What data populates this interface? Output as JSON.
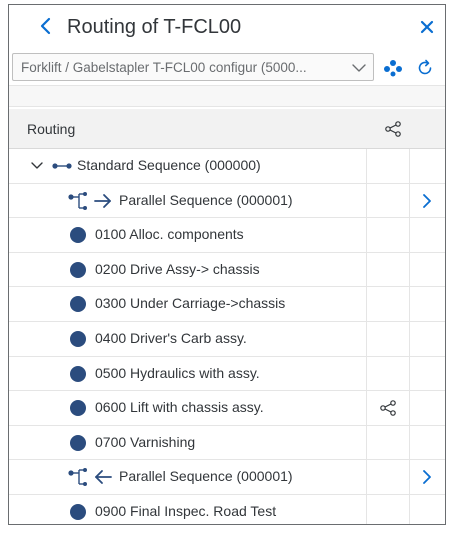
{
  "header": {
    "title": "Routing of T-FCL00"
  },
  "toolbar": {
    "select_value": "Forklift / Gabelstapler T-FCL00 configur (5000..."
  },
  "table": {
    "column_header": "Routing",
    "rows": [
      {
        "kind": "sequence",
        "label": "Standard Sequence (000000)"
      },
      {
        "kind": "parallel-in",
        "label": "Parallel Sequence (000001)"
      },
      {
        "kind": "operation",
        "label": "0100 Alloc. components"
      },
      {
        "kind": "operation",
        "label": "0200 Drive Assy-> chassis"
      },
      {
        "kind": "operation",
        "label": "0300 Under Carriage->chassis"
      },
      {
        "kind": "operation",
        "label": "0400 Driver's Carb assy."
      },
      {
        "kind": "operation",
        "label": "0500 Hydraulics with assy."
      },
      {
        "kind": "operation",
        "label": "0600 Lift with chassis assy."
      },
      {
        "kind": "operation",
        "label": "0700 Varnishing"
      },
      {
        "kind": "parallel-out",
        "label": "Parallel Sequence (000001)"
      },
      {
        "kind": "operation",
        "label": "0900 Final Inspec. Road Test"
      }
    ]
  },
  "colors": {
    "operation_dot": "#2b4c7e",
    "accent": "#0a6ed1",
    "text": "#32363a"
  },
  "icons": {
    "back": "chevron-left-icon",
    "close": "close-icon",
    "dropdown": "chevron-down-icon",
    "network": "network-icon",
    "refresh": "refresh-icon",
    "share": "share-icon",
    "expander": "chevron-down-icon",
    "navigation": "chevron-right-icon"
  }
}
